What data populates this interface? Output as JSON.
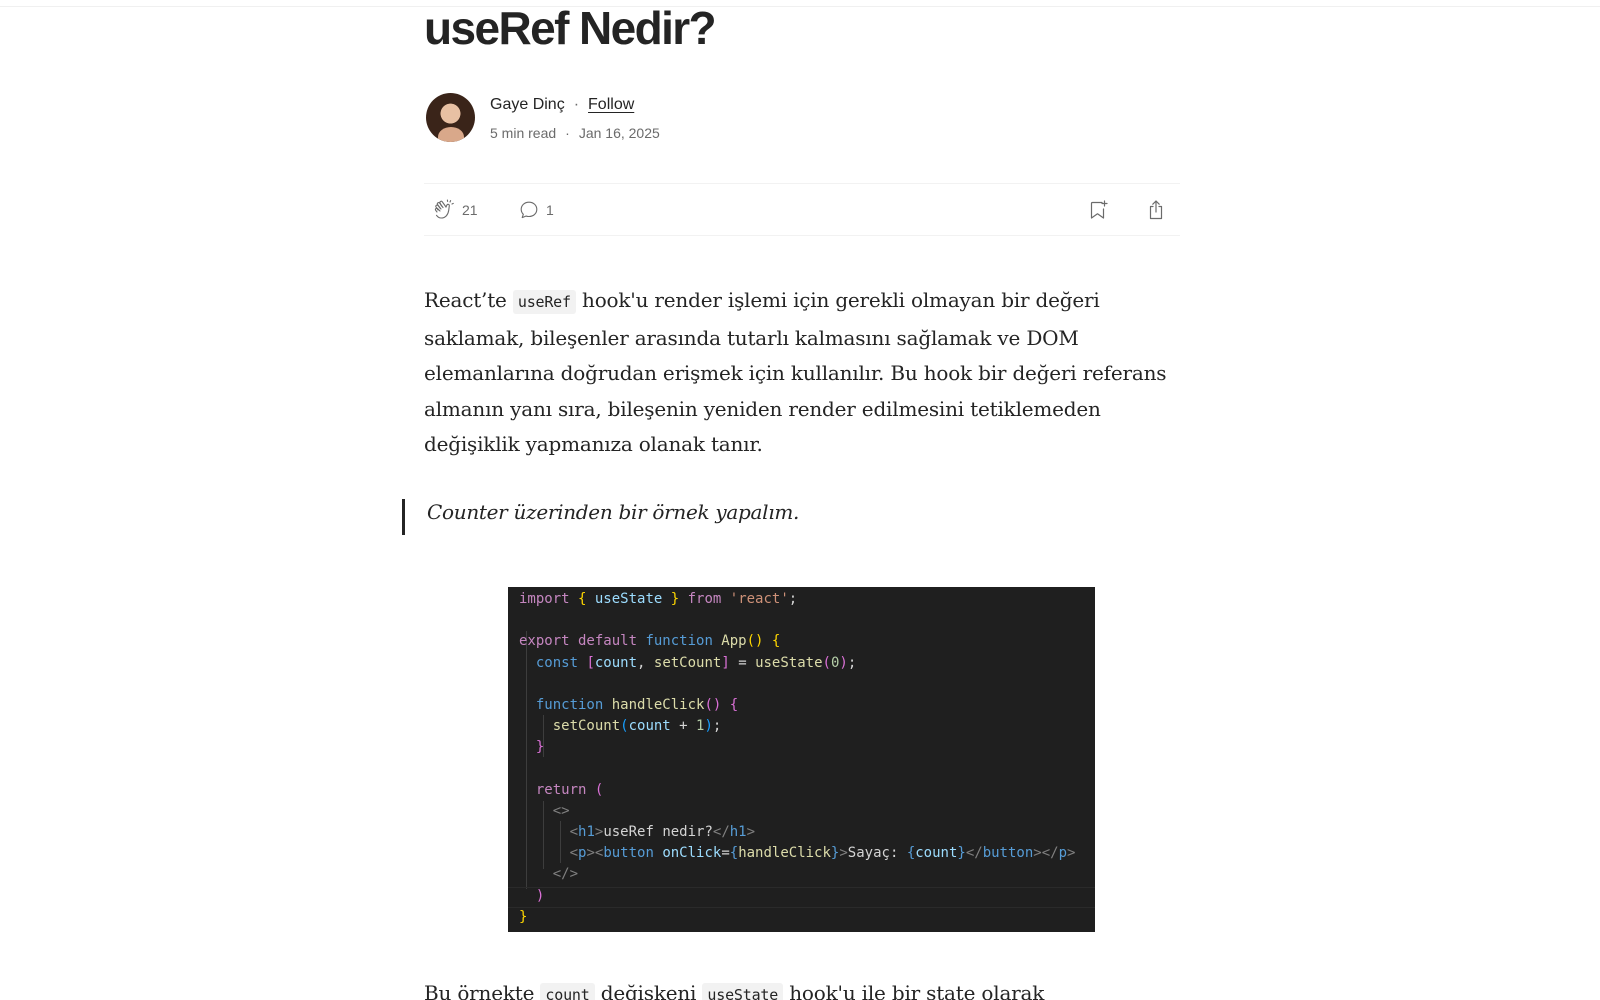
{
  "article": {
    "title": "useRef Nedir?",
    "author": {
      "name": "Gaye Dinç",
      "separator": "·",
      "follow_label": "Follow"
    },
    "meta": {
      "read_time": "5 min read",
      "separator": "·",
      "date": "Jan 16, 2025"
    },
    "actions": {
      "claps": "21",
      "responses": "1",
      "icons": [
        "clap-icon",
        "comment-icon",
        "bookmark-add-icon",
        "share-icon"
      ]
    },
    "paragraph1": {
      "before_code": "React’te ",
      "code": "useRef",
      "after_code": " hook'u render işlemi için gerekli olmayan bir değeri saklamak, bileşenler arasında tutarlı kalmasını sağlamak ve DOM elemanlarına doğrudan erişmek için kullanılır. Bu hook bir değeri referans almanın yanı sıra, bileşenin yeniden render edilmesini tetiklemeden değişiklik yapmanıza olanak tanır."
    },
    "quote": "Counter üzerinden bir örnek yapalım.",
    "code_image": {
      "colors": {
        "background": "#1f1f1f",
        "keyword": "#c586c0",
        "blue": "#569cd6",
        "function": "#dcdcaa",
        "variable": "#9cdcfe",
        "string": "#ce9178"
      },
      "lines": [
        [
          [
            "import",
            "kw"
          ],
          [
            " ",
            "txt"
          ],
          [
            "{",
            "br1"
          ],
          [
            " useState ",
            "var"
          ],
          [
            "}",
            "br1"
          ],
          [
            " from ",
            "kw"
          ],
          [
            "'react'",
            "str"
          ],
          [
            ";",
            "txt"
          ]
        ],
        [],
        [
          [
            "export",
            "kw"
          ],
          [
            " default ",
            "kw"
          ],
          [
            "function",
            "blue"
          ],
          [
            " App",
            "fn"
          ],
          [
            "()",
            "br1"
          ],
          [
            " ",
            "txt"
          ],
          [
            "{",
            "br1"
          ]
        ],
        [
          [
            "  const ",
            "blue"
          ],
          [
            "[",
            "br2"
          ],
          [
            "count",
            "var"
          ],
          [
            ", ",
            "txt"
          ],
          [
            "setCount",
            "fn"
          ],
          [
            "]",
            "br2"
          ],
          [
            " = ",
            "txt"
          ],
          [
            "useState",
            "fn"
          ],
          [
            "(",
            "br2"
          ],
          [
            "0",
            "num"
          ],
          [
            ")",
            "br2"
          ],
          [
            ";",
            "txt"
          ]
        ],
        [],
        [
          [
            "  function ",
            "blue"
          ],
          [
            "handleClick",
            "fn"
          ],
          [
            "()",
            "br2"
          ],
          [
            " ",
            "txt"
          ],
          [
            "{",
            "br2"
          ]
        ],
        [
          [
            "    setCount",
            "fn"
          ],
          [
            "(",
            "br3"
          ],
          [
            "count",
            "var"
          ],
          [
            " + ",
            "txt"
          ],
          [
            "1",
            "num"
          ],
          [
            ")",
            "br3"
          ],
          [
            ";",
            "txt"
          ]
        ],
        [
          [
            "  }",
            "br2"
          ]
        ],
        [],
        [
          [
            "  return ",
            "kw"
          ],
          [
            "(",
            "br2"
          ]
        ],
        [
          [
            "    <>",
            "punc"
          ]
        ],
        [
          [
            "      <",
            "punc"
          ],
          [
            "h1",
            "tag"
          ],
          [
            ">",
            "punc"
          ],
          [
            "useRef nedir?",
            "txt"
          ],
          [
            "</",
            "punc"
          ],
          [
            "h1",
            "tag"
          ],
          [
            ">",
            "punc"
          ]
        ],
        [
          [
            "      <",
            "punc"
          ],
          [
            "p",
            "tag"
          ],
          [
            "><",
            "punc"
          ],
          [
            "button",
            "tag"
          ],
          [
            " onClick",
            "var"
          ],
          [
            "=",
            "txt"
          ],
          [
            "{",
            "blue"
          ],
          [
            "handleClick",
            "fn"
          ],
          [
            "}",
            "blue"
          ],
          [
            ">",
            "punc"
          ],
          [
            "Sayaç: ",
            "txt"
          ],
          [
            "{",
            "blue"
          ],
          [
            "count",
            "var"
          ],
          [
            "}",
            "blue"
          ],
          [
            "</",
            "punc"
          ],
          [
            "button",
            "tag"
          ],
          [
            "></",
            "punc"
          ],
          [
            "p",
            "tag"
          ],
          [
            ">",
            "punc"
          ]
        ],
        [
          [
            "    </>",
            "punc"
          ]
        ],
        [
          [
            "  )",
            "br2"
          ]
        ],
        [
          [
            "}",
            "br1"
          ]
        ]
      ]
    },
    "paragraph2": {
      "p1": "Bu örnekte ",
      "code1": "count",
      "p2": " değişkeni ",
      "code2": "useState",
      "p3": " hook'u ile bir state olarak"
    }
  }
}
